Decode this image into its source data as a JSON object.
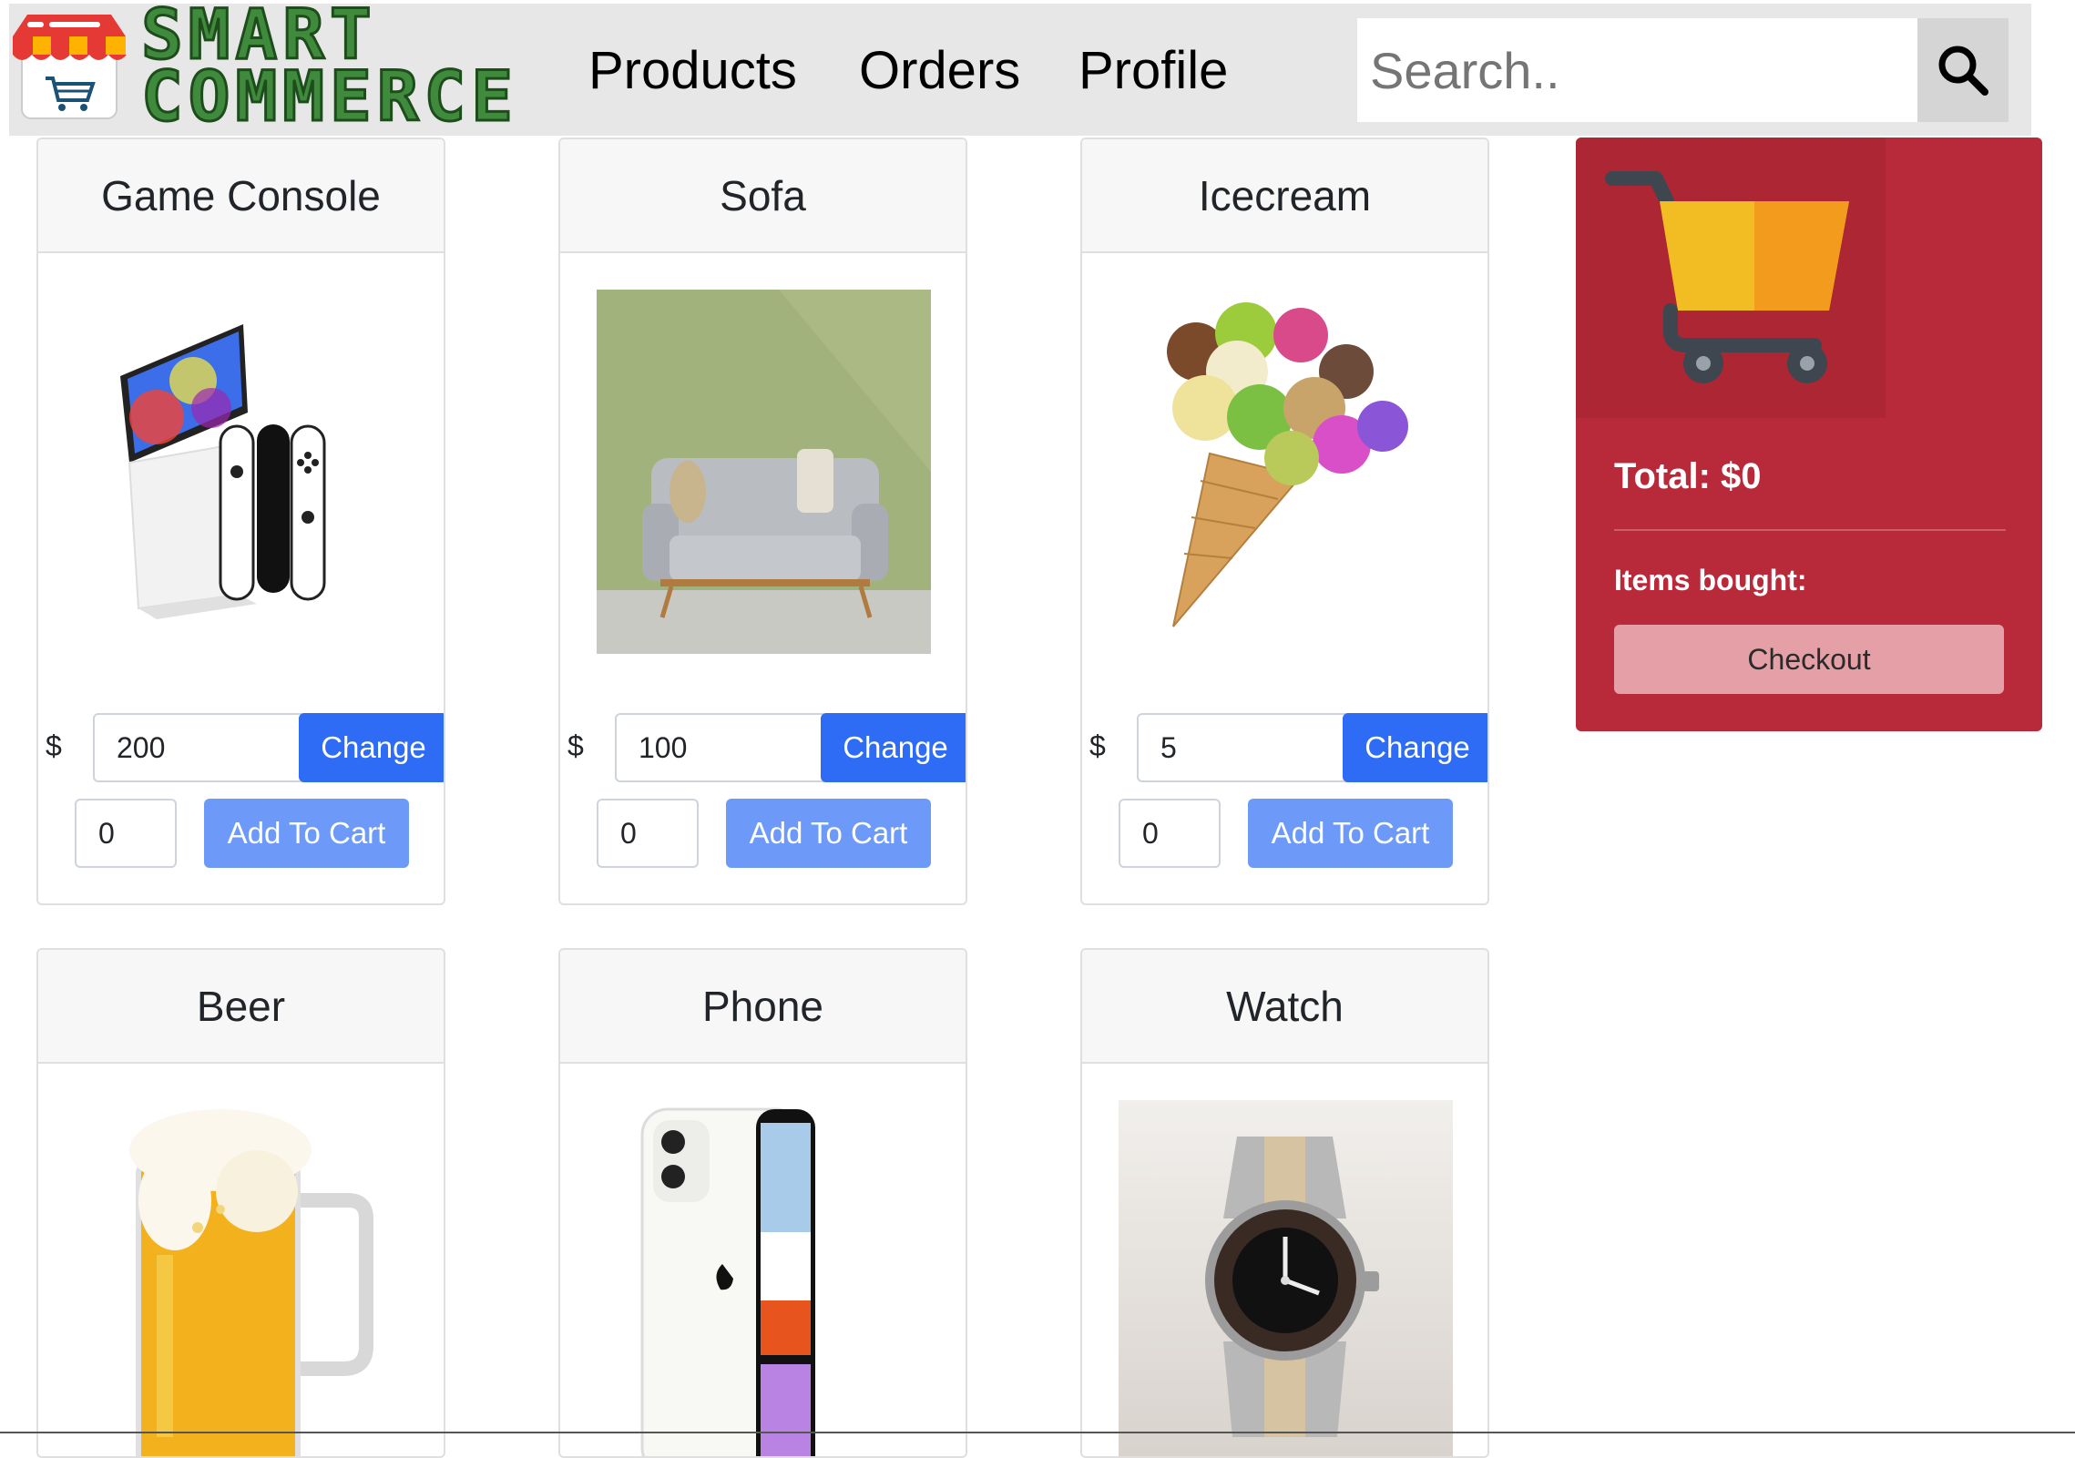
{
  "brand": {
    "line1": "SMART",
    "line2": "COMMERCE"
  },
  "nav": {
    "products": "Products",
    "orders": "Orders",
    "profile": "Profile"
  },
  "search": {
    "placeholder": "Search..",
    "icon": "search-icon"
  },
  "products": [
    {
      "name": "Game Console",
      "currency": "$",
      "price": "200",
      "change_label": "Change",
      "qty": "0",
      "add_label": "Add To Cart",
      "image": "game-console-image"
    },
    {
      "name": "Sofa",
      "currency": "$",
      "price": "100",
      "change_label": "Change",
      "qty": "0",
      "add_label": "Add To Cart",
      "image": "sofa-image"
    },
    {
      "name": "Icecream",
      "currency": "$",
      "price": "5",
      "change_label": "Change",
      "qty": "0",
      "add_label": "Add To Cart",
      "image": "icecream-image"
    },
    {
      "name": "Beer",
      "image": "beer-image"
    },
    {
      "name": "Phone",
      "image": "phone-image"
    },
    {
      "name": "Watch",
      "image": "watch-image"
    }
  ],
  "cart": {
    "total": "Total: $0",
    "items_label": "Items bought:",
    "checkout_label": "Checkout",
    "icon": "shopping-cart-icon"
  },
  "colors": {
    "navbar": "#e7e7e7",
    "primary_button": "#2f6cf6",
    "add_button": "#6d9af8",
    "cart_panel": "#b82a39",
    "checkout_button": "#e59fa7"
  }
}
